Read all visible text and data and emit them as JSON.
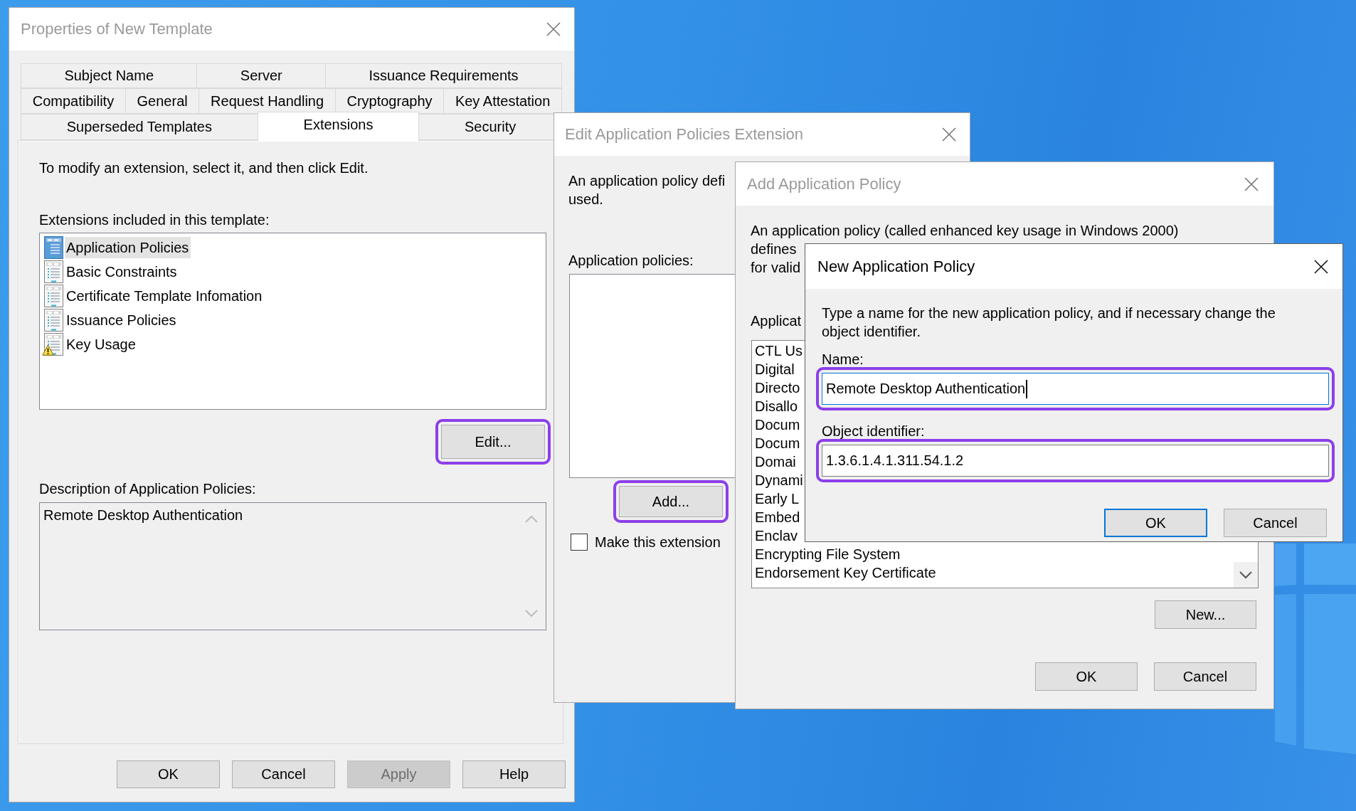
{
  "properties_window": {
    "title": "Properties of New Template",
    "active": false,
    "tab_rows": [
      [
        {
          "label": "Subject Name",
          "selected": false
        },
        {
          "label": "Server",
          "selected": false
        },
        {
          "label": "Issuance Requirements",
          "selected": false
        }
      ],
      [
        {
          "label": "Compatibility",
          "selected": false
        },
        {
          "label": "General",
          "selected": false
        },
        {
          "label": "Request Handling",
          "selected": false
        },
        {
          "label": "Cryptography",
          "selected": false
        },
        {
          "label": "Key Attestation",
          "selected": false
        }
      ],
      [
        {
          "label": "Superseded Templates",
          "selected": false
        },
        {
          "label": "Extensions",
          "selected": true
        },
        {
          "label": "Security",
          "selected": false
        }
      ]
    ],
    "instruction": "To modify an extension, select it, and then click Edit.",
    "extensions_label": "Extensions included in this template:",
    "extensions": [
      {
        "label": "Application Policies",
        "selected": true,
        "warning": false
      },
      {
        "label": "Basic Constraints",
        "selected": false,
        "warning": false
      },
      {
        "label": "Certificate Template Infomation",
        "selected": false,
        "warning": false
      },
      {
        "label": "Issuance Policies",
        "selected": false,
        "warning": false
      },
      {
        "label": "Key Usage",
        "selected": false,
        "warning": true
      }
    ],
    "edit_button": {
      "label": "Edit...",
      "highlighted": true
    },
    "description_label": "Description of Application Policies:",
    "description": "Remote Desktop Authentication",
    "buttons": [
      {
        "label": "OK",
        "disabled": false
      },
      {
        "label": "Cancel",
        "disabled": false
      },
      {
        "label": "Apply",
        "disabled": true
      },
      {
        "label": "Help",
        "disabled": false
      }
    ]
  },
  "edit_extension_window": {
    "title": "Edit Application Policies Extension",
    "active": false,
    "intro_lines": [
      "An application policy defi",
      "used."
    ],
    "policies_label": "Application policies:",
    "add_button": {
      "label": "Add...",
      "highlighted": true
    },
    "critical_checkbox": {
      "label": "Make this extension",
      "checked": false
    }
  },
  "add_policy_window": {
    "title": "Add Application Policy",
    "active": false,
    "intro_lines": [
      "An application policy (called enhanced key usage in Windows 2000)",
      "defines",
      "for valid"
    ],
    "policies_label": "Applicat",
    "policies": [
      "CTL Us",
      "Digital",
      "Directo",
      "Disallo",
      "Docum",
      "Docum",
      "Domai",
      "Dynami",
      "Early L",
      "Embed",
      "Enclav",
      "Encrypting File System",
      "Endorsement Key Certificate"
    ],
    "new_button": {
      "label": "New..."
    },
    "buttons": [
      {
        "label": "OK"
      },
      {
        "label": "Cancel"
      }
    ]
  },
  "new_policy_window": {
    "title": "New Application Policy",
    "active": true,
    "instruction_lines": [
      "Type a name for the new application policy, and if necessary change the",
      "object identifier."
    ],
    "name_label": "Name:",
    "name_field": {
      "value": "Remote Desktop Authentication",
      "focused": true,
      "highlighted": true
    },
    "oid_label": "Object identifier:",
    "oid_field": {
      "value": "1.3.6.1.4.1.311.54.1.2",
      "focused": false,
      "highlighted": true
    },
    "buttons": [
      {
        "label": "OK",
        "default": true
      },
      {
        "label": "Cancel",
        "default": false
      }
    ]
  }
}
